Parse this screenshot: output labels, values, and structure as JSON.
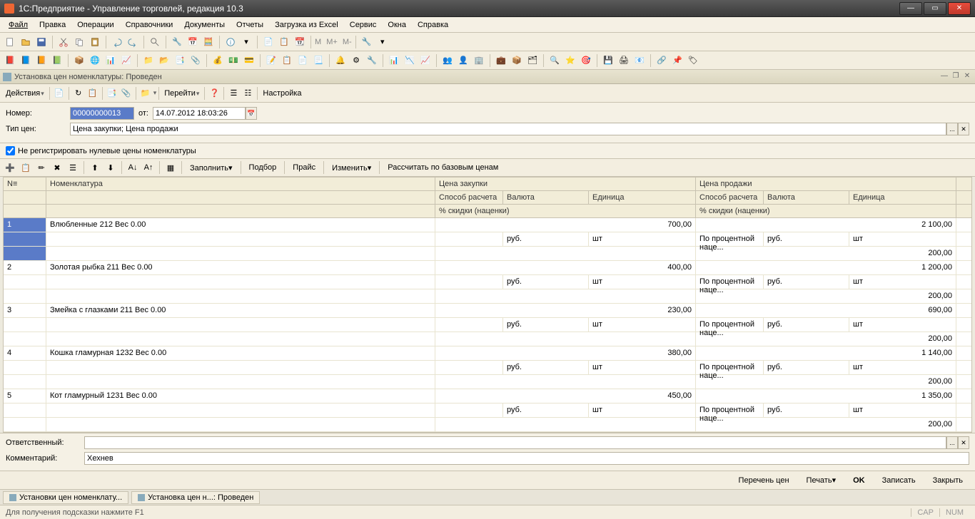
{
  "window": {
    "title": "1С:Предприятие - Управление торговлей, редакция 10.3"
  },
  "menu": [
    "Файл",
    "Правка",
    "Операции",
    "Справочники",
    "Документы",
    "Отчеты",
    "Загрузка из Excel",
    "Сервис",
    "Окна",
    "Справка"
  ],
  "flat_m": [
    "M",
    "M+",
    "M-"
  ],
  "doc": {
    "header": "Установка цен номенклатуры: Проведен",
    "actions": "Действия",
    "goto": "Перейти",
    "settings": "Настройка",
    "number_label": "Номер:",
    "number": "00000000013",
    "from_label": "от:",
    "date": "14.07.2012 18:03:26",
    "type_label": "Тип цен:",
    "type_value": "Цена закупки; Цена продажи",
    "checkbox": "Не регистрировать нулевые цены номенклатуры",
    "checked": true
  },
  "gridbar": {
    "fill": "Заполнить",
    "select": "Подбор",
    "price": "Прайс",
    "change": "Изменить",
    "recalc": "Рассчитать по базовым ценам"
  },
  "headers": {
    "idx": "N≡",
    "nom": "Номенклатура",
    "pz": "Цена закупки",
    "pp": "Цена продажи",
    "calc": "Способ расчета",
    "cur": "Валюта",
    "unit": "Единица",
    "disc": "% скидки (наценки)"
  },
  "rows": [
    {
      "n": "1",
      "nom": "Влюбленные 212 Вес 0.00",
      "pz": "700,00",
      "pz_cur": "руб.",
      "pz_unit": "шт",
      "pp": "2 100,00",
      "pp_calc": "По процентной наце...",
      "pp_cur": "руб.",
      "pp_unit": "шт",
      "pp_disc": "200,00"
    },
    {
      "n": "2",
      "nom": "Золотая рыбка 211 Вес 0.00",
      "pz": "400,00",
      "pz_cur": "руб.",
      "pz_unit": "шт",
      "pp": "1 200,00",
      "pp_calc": "По процентной наце...",
      "pp_cur": "руб.",
      "pp_unit": "шт",
      "pp_disc": "200,00"
    },
    {
      "n": "3",
      "nom": "Змейка с глазками 211 Вес 0.00",
      "pz": "230,00",
      "pz_cur": "руб.",
      "pz_unit": "шт",
      "pp": "690,00",
      "pp_calc": "По процентной наце...",
      "pp_cur": "руб.",
      "pp_unit": "шт",
      "pp_disc": "200,00"
    },
    {
      "n": "4",
      "nom": "Кошка гламурная 1232 Вес 0.00",
      "pz": "380,00",
      "pz_cur": "руб.",
      "pz_unit": "шт",
      "pp": "1 140,00",
      "pp_calc": "По процентной наце...",
      "pp_cur": "руб.",
      "pp_unit": "шт",
      "pp_disc": "200,00"
    },
    {
      "n": "5",
      "nom": "Кот гламурный 1231 Вес 0.00",
      "pz": "450,00",
      "pz_cur": "руб.",
      "pz_unit": "шт",
      "pp": "1 350,00",
      "pp_calc": "По процентной наце...",
      "pp_cur": "руб.",
      "pp_unit": "шт",
      "pp_disc": "200,00"
    }
  ],
  "footer": {
    "resp_label": "Ответственный:",
    "resp_value": "",
    "comm_label": "Комментарий:",
    "comm_value": "Хехнев"
  },
  "buttons": {
    "list": "Перечень цен",
    "print": "Печать",
    "ok": "OK",
    "save": "Записать",
    "close": "Закрыть"
  },
  "tabs": [
    "Установки цен номенклату...",
    "Установка цен н...: Проведен"
  ],
  "status": {
    "hint": "Для получения подсказки нажмите F1",
    "cap": "CAP",
    "num": "NUM"
  }
}
